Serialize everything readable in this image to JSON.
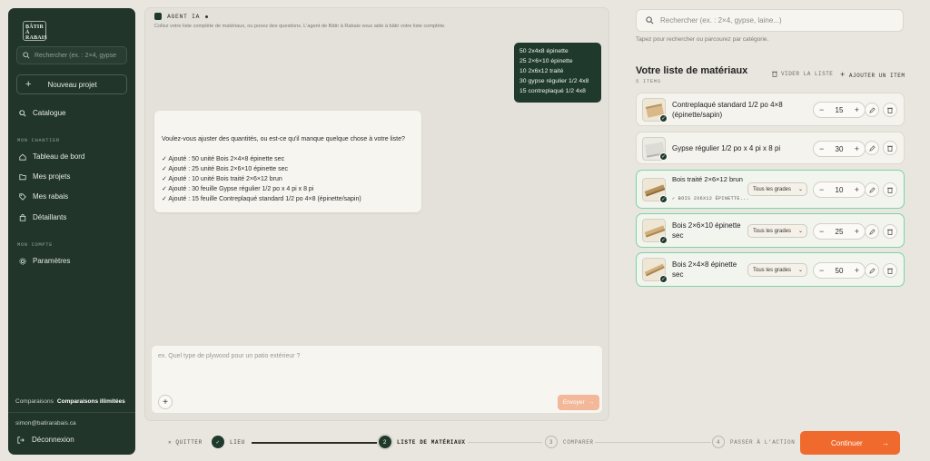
{
  "sidebar": {
    "logo": "BÂTIR À RABAIS",
    "search_placeholder": "Rechercher (ex. : 2×4, gypse",
    "new_project": "Nouveau projet",
    "catalogue": "Catalogue",
    "section_chantier": "MON CHANTIER",
    "items": [
      "Tableau de bord",
      "Mes projets",
      "Mes rabais",
      "Détaillants"
    ],
    "section_compte": "MON COMPTE",
    "settings": "Paramètres",
    "comparisons_label": "Comparaisons",
    "comparisons_value": "Comparaisons illimitées",
    "email": "simon@batirarabais.ca",
    "logout": "Déconnexion"
  },
  "chat": {
    "title": "AGENT IA",
    "subtitle": "Collez votre liste complète de matériaux, ou posez des questions. L'agent de Bâtir à Rabais vous aide à bâtir votre liste complète.",
    "user_lines": [
      "50 2x4x8 épinette",
      "25 2×6×10 épinette",
      "10 2x6x12 traité",
      "30 gypse régulier 1/2 4x8",
      "15 contreplaqué 1/2 4x8"
    ],
    "ai_question": "Voulez-vous ajuster des quantités, ou est-ce qu'il manque quelque chose à votre liste?",
    "ai_lines": [
      "✓ Ajouté : 50 unité Bois 2×4×8 épinette sec",
      "✓ Ajouté : 25 unité Bois 2×6×10 épinette sec",
      "✓ Ajouté : 10 unité Bois traité 2×6×12 brun",
      "✓ Ajouté : 30 feuille Gypse régulier 1/2 po x 4 pi x 8 pi",
      "✓ Ajouté : 15 feuille Contreplaqué standard 1/2 po 4×8 (épinette/sapin)"
    ],
    "input_placeholder": "ex. Quel type de plywood pour un patio extérieur ?",
    "send": "Envoyer"
  },
  "materials": {
    "search_placeholder": "Rechercher (ex. : 2×4, gypse, laine...)",
    "hint": "Tapez pour rechercher ou parcourez par catégorie.",
    "title": "Votre liste de matériaux",
    "count": "5 ITEMS",
    "clear": "VIDER LA LISTE",
    "add": "AJOUTER UN ITEM",
    "items": [
      {
        "name": "Contreplaqué standard 1/2 po 4×8 (épinette/sapin)",
        "qty": "15",
        "grade": "",
        "sub": ""
      },
      {
        "name": "Gypse régulier 1/2 po x 4 pi x 8 pi",
        "qty": "30",
        "grade": "",
        "sub": ""
      },
      {
        "name": "Bois traité 2×6×12 brun",
        "qty": "10",
        "grade": "Tous les grades",
        "sub": "✓ BOIS 2X6X12 ÉPINETTE..."
      },
      {
        "name": "Bois 2×6×10 épinette sec",
        "qty": "25",
        "grade": "Tous les grades",
        "sub": ""
      },
      {
        "name": "Bois 2×4×8 épinette sec",
        "qty": "50",
        "grade": "Tous les grades",
        "sub": ""
      }
    ]
  },
  "footer": {
    "quit": "QUITTER",
    "steps": [
      {
        "num": "✓",
        "label": "LIEU"
      },
      {
        "num": "2",
        "label": "LISTE DE MATÉRIAUX"
      },
      {
        "num": "3",
        "label": "COMPARER"
      },
      {
        "num": "4",
        "label": "PASSER À L'ACTION"
      }
    ],
    "continue": "Continuer",
    "continue_arrow": "→"
  },
  "colors": {
    "sidebar": "#22352b",
    "accent": "#ef6a2c",
    "selected_border": "#7fd3a6"
  }
}
